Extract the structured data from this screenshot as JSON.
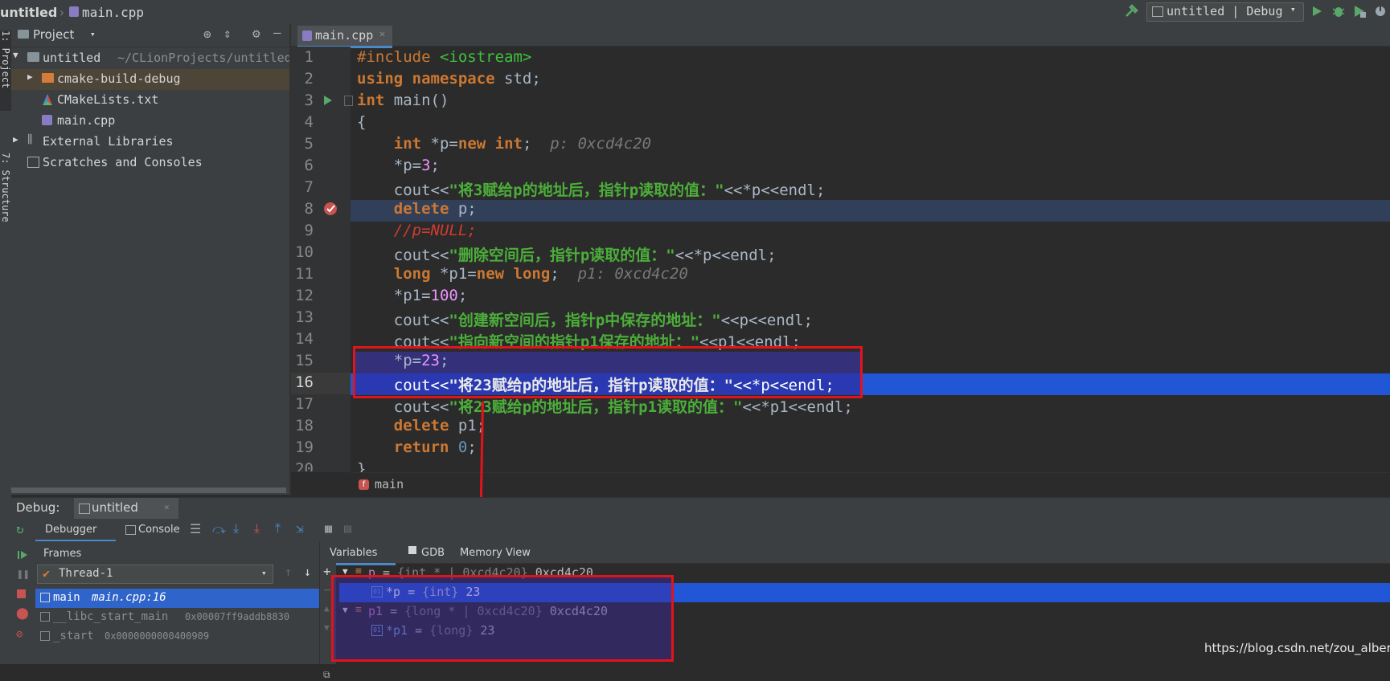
{
  "breadcrumb": {
    "project": "untitled",
    "file": "main.cpp"
  },
  "run_config": "untitled | Debug",
  "side_tabs": {
    "project": "1: Project",
    "structure": "7: Structure"
  },
  "project_panel": {
    "title": "Project",
    "root": {
      "name": "untitled",
      "path": "~/CLionProjects/untitled"
    },
    "items": [
      {
        "name": "cmake-build-debug",
        "type": "folder"
      },
      {
        "name": "CMakeLists.txt",
        "type": "cmake-file"
      },
      {
        "name": "main.cpp",
        "type": "cpp-file"
      },
      {
        "name": "External Libraries",
        "type": "library"
      },
      {
        "name": "Scratches and Consoles",
        "type": "scratches"
      }
    ]
  },
  "editor": {
    "tab": "main.cpp",
    "line_numbers": [
      "1",
      "2",
      "3",
      "4",
      "5",
      "6",
      "7",
      "8",
      "9",
      "10",
      "11",
      "12",
      "13",
      "14",
      "15",
      "16",
      "17",
      "18",
      "19",
      "20"
    ],
    "lines": {
      "l1a": "#include",
      "l1b": "<iostream>",
      "l2a": "using namespace",
      "l2b": "std;",
      "l3a": "int",
      "l3b": "main()",
      "l4": "{",
      "l5a": "int",
      "l5b": "*p=",
      "l5c": "new int",
      "l5d": ";",
      "l5hint": "p: 0xcd4c20",
      "l6a": "*p=",
      "l6b": "3",
      "l6c": ";",
      "l7a": "cout<<",
      "l7b": "\"将3赋给p的地址后，指针p读取的值：\"",
      "l7c": "<<*p<<endl;",
      "l8a": "delete",
      "l8b": "p;",
      "l9": "//p=NULL;",
      "l10a": "cout<<",
      "l10b": "\"删除空间后，指针p读取的值：\"",
      "l10c": "<<*p<<endl;",
      "l11a": "long",
      "l11b": "*p1=",
      "l11c": "new long",
      "l11d": ";",
      "l11hint": "p1: 0xcd4c20",
      "l12a": "*p1=",
      "l12b": "100",
      "l12c": ";",
      "l13a": "cout<<",
      "l13b": "\"创建新空间后，指针p中保存的地址：\"",
      "l13c": "<<p<<endl;",
      "l14a": "cout<<",
      "l14b": "\"指向新空间的指针p1保存的地址：\"",
      "l14c": "<<p1<<endl;",
      "l15a": "*p=",
      "l15b": "23",
      "l15c": ";",
      "l16a": "cout<<",
      "l16b": "\"将23赋给p的地址后，指针p读取的值：\"",
      "l16c": "<<*p<<endl;",
      "l17a": "cout<<",
      "l17b": "\"将23赋给p的地址后，指针p1读取的值：\"",
      "l17c": "<<*p1<<endl;",
      "l18a": "delete",
      "l18b": "p1;",
      "l19a": "return",
      "l19b": "0",
      "l19c": ";",
      "l20": "}"
    },
    "footer_function": "main"
  },
  "debug": {
    "label": "Debug:",
    "session": "untitled",
    "tabs": {
      "debugger": "Debugger",
      "console": "Console"
    },
    "frames_title": "Frames",
    "thread": "Thread-1",
    "frames": [
      {
        "name": "main",
        "loc": "main.cpp:16"
      },
      {
        "name": "__libc_start_main",
        "loc": "0x00007ff9addb8830"
      },
      {
        "name": "_start",
        "loc": "0x0000000000400909"
      }
    ],
    "var_tabs": {
      "variables": "Variables",
      "gdb": "GDB",
      "memory": "Memory View"
    },
    "variables": [
      {
        "name": "p",
        "type": "{int * | 0xcd4c20}",
        "value": "0xcd4c20"
      },
      {
        "name": "*p",
        "type": "{int}",
        "value": "23"
      },
      {
        "name": "p1",
        "type": "{long * | 0xcd4c20}",
        "value": "0xcd4c20"
      },
      {
        "name": "*p1",
        "type": "{long}",
        "value": "23"
      }
    ]
  },
  "watermark": "https://blog.csdn.net/zou_albert",
  "colors": {
    "accent": "#4a88c7",
    "annotation": "#e3131a",
    "selection": "#2156d6"
  }
}
